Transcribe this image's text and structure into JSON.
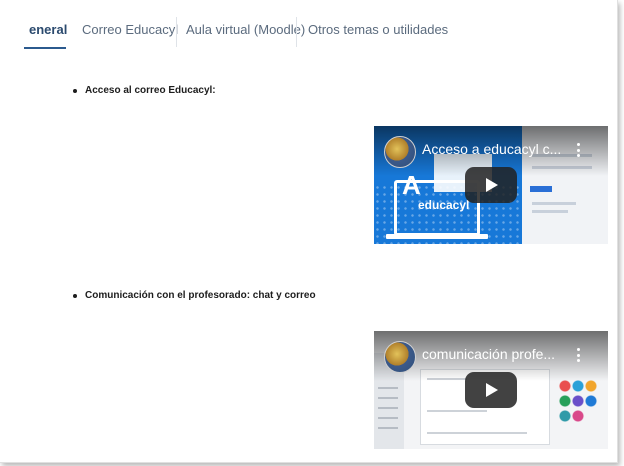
{
  "tabs": [
    {
      "label": "eneral",
      "active": true
    },
    {
      "label": "Correo Educacyl",
      "active": false
    },
    {
      "label": "Aula virtual (Moodle)",
      "active": false
    },
    {
      "label": "Otros temas o utilidades",
      "active": false
    }
  ],
  "sections": [
    {
      "heading": "Acceso al correo Educacyl:",
      "video": {
        "title": "Acceso a educacyl c...",
        "thumbnail_text": "educacyl",
        "thumbnail_logo": "A"
      }
    },
    {
      "heading": "Comunicación con el profesorado: chat y correo",
      "video": {
        "title": "comunicación profe..."
      }
    }
  ],
  "icons": {
    "menu": "more-vert-icon",
    "play": "play-icon",
    "avatar": "channel-avatar"
  },
  "colors": {
    "active_tab": "#2b4a6e",
    "tab_text": "#5b6b7e",
    "thumbnail_blue": "#1778d8"
  }
}
